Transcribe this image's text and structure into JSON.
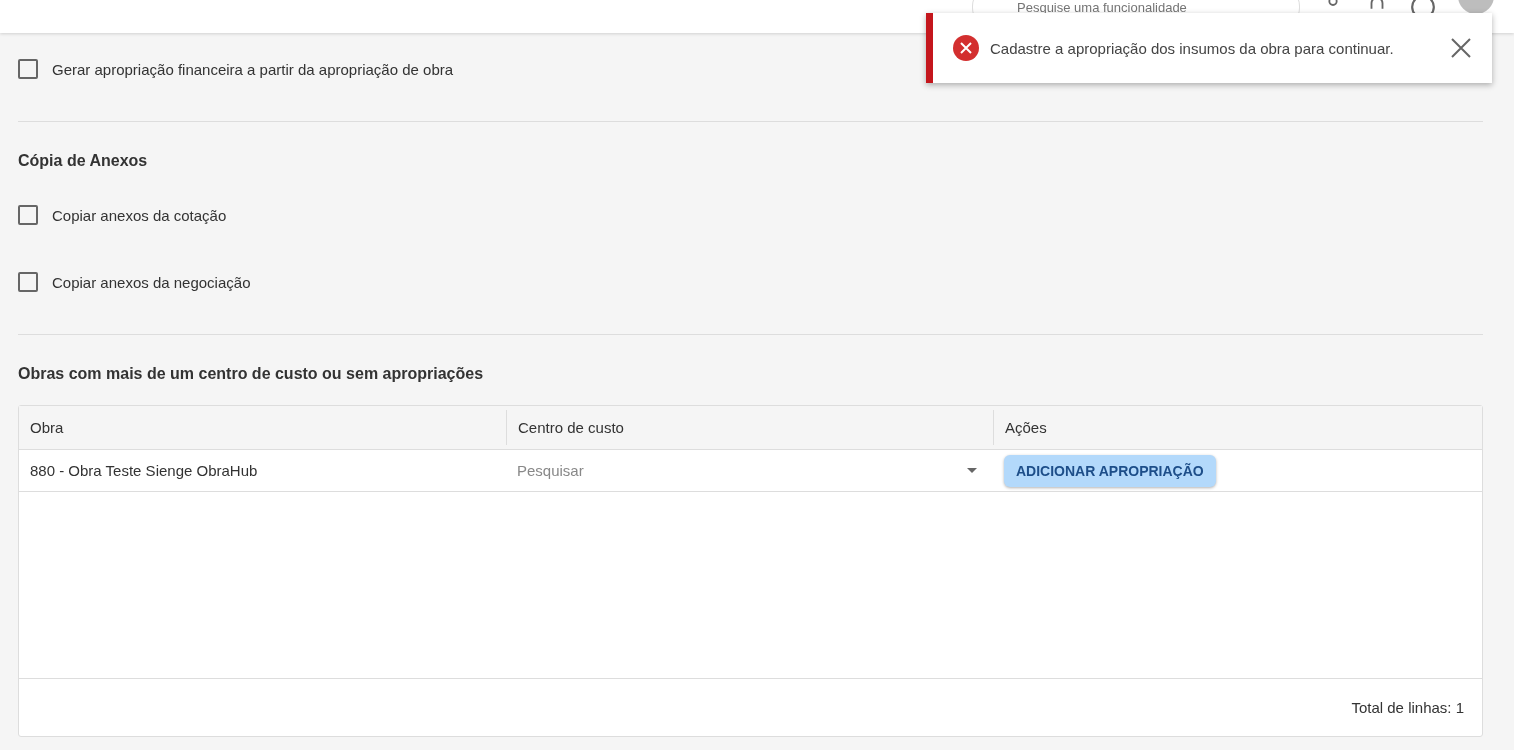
{
  "header": {
    "search": {
      "placeholder": "Pesquise uma funcionalidade"
    }
  },
  "toast": {
    "kind": "error",
    "message": "Cadastre a apropriação dos insumos da obra para continuar."
  },
  "sections": [
    {
      "options": [
        {
          "label": "Gerar apropriação financeira a partir da apropriação de obra",
          "checked": false
        }
      ]
    },
    {
      "title": "Cópia de Anexos",
      "options": [
        {
          "label": "Copiar anexos da cotação",
          "checked": false
        },
        {
          "label": "Copiar anexos da negociação",
          "checked": false
        }
      ]
    }
  ],
  "table": {
    "title": "Obras com mais de um centro de custo ou sem apropriações",
    "columns": [
      "Obra",
      "Centro de custo",
      "Ações"
    ],
    "rows": [
      {
        "obra": "880 - Obra Teste Sienge ObraHub",
        "centro_placeholder": "Pesquisar",
        "action": "ADICIONAR APROPRIAÇÃO"
      }
    ],
    "footer": "Total de linhas: 1"
  }
}
